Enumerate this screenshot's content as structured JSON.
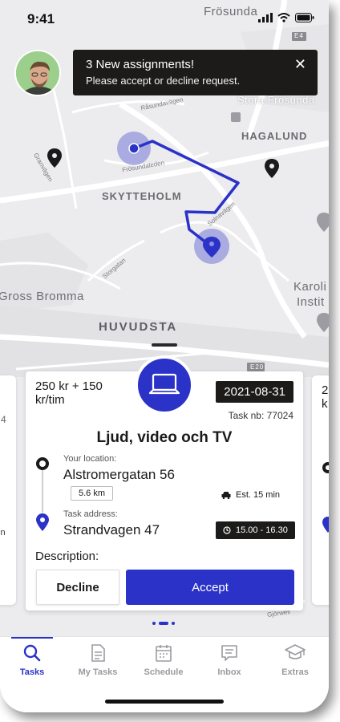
{
  "status_bar": {
    "time": "9:41"
  },
  "map": {
    "labels": {
      "frosunda": "Frösunda",
      "stora_frosunda": "Stora Frösunda",
      "hagalund": "HAGALUND",
      "skytteholm": "SKYTTEHOLM",
      "huvudsta": "HUVUDSTA",
      "bromma": "Gross Bromma",
      "karolinska": "Karoli",
      "institutet": "Instit",
      "rasundavagen": "Råsundavägen",
      "frosundaleden": "Frösundaleden",
      "granvagen": "Granvägen",
      "storgatan": "Storgatan",
      "solnavagen": "Solnavägen",
      "gjorwell": "Gjörwell",
      "e4": "E4",
      "e20": "E20"
    },
    "pin_color": "#1a1a1a",
    "route_color": "#2b32c8"
  },
  "notification": {
    "title": "3 New assignments!",
    "message": "Please accept or decline request.",
    "close_icon": "close-icon"
  },
  "task_card": {
    "price": "250 kr + 150 kr/tim",
    "date": "2021-08-31",
    "task_number": "Task nb: 77024",
    "title": "Ljud, video och TV",
    "icon": "laptop-icon",
    "your_location_label": "Your location:",
    "your_location": "Alstromergatan 56",
    "distance": "5.6 km",
    "estimate": "Est. 15 min",
    "task_address_label": "Task address:",
    "task_address": "Strandvagen 47",
    "time_window": "15.00 - 16.30",
    "description_label": "Description:",
    "decline_label": "Decline",
    "accept_label": "Accept"
  },
  "side_cards": {
    "right_price": "2",
    "right_price2": "k",
    "left_text1": "4",
    "left_text2": "in"
  },
  "tabs": [
    {
      "label": "Tasks",
      "icon": "search-icon",
      "active": true
    },
    {
      "label": "My Tasks",
      "icon": "document-icon",
      "active": false
    },
    {
      "label": "Schedule",
      "icon": "calendar-icon",
      "active": false
    },
    {
      "label": "Inbox",
      "icon": "chat-icon",
      "active": false
    },
    {
      "label": "Extras",
      "icon": "graduation-cap-icon",
      "active": false
    }
  ],
  "colors": {
    "accent": "#2b32c8",
    "dark": "#1c1b1a"
  }
}
